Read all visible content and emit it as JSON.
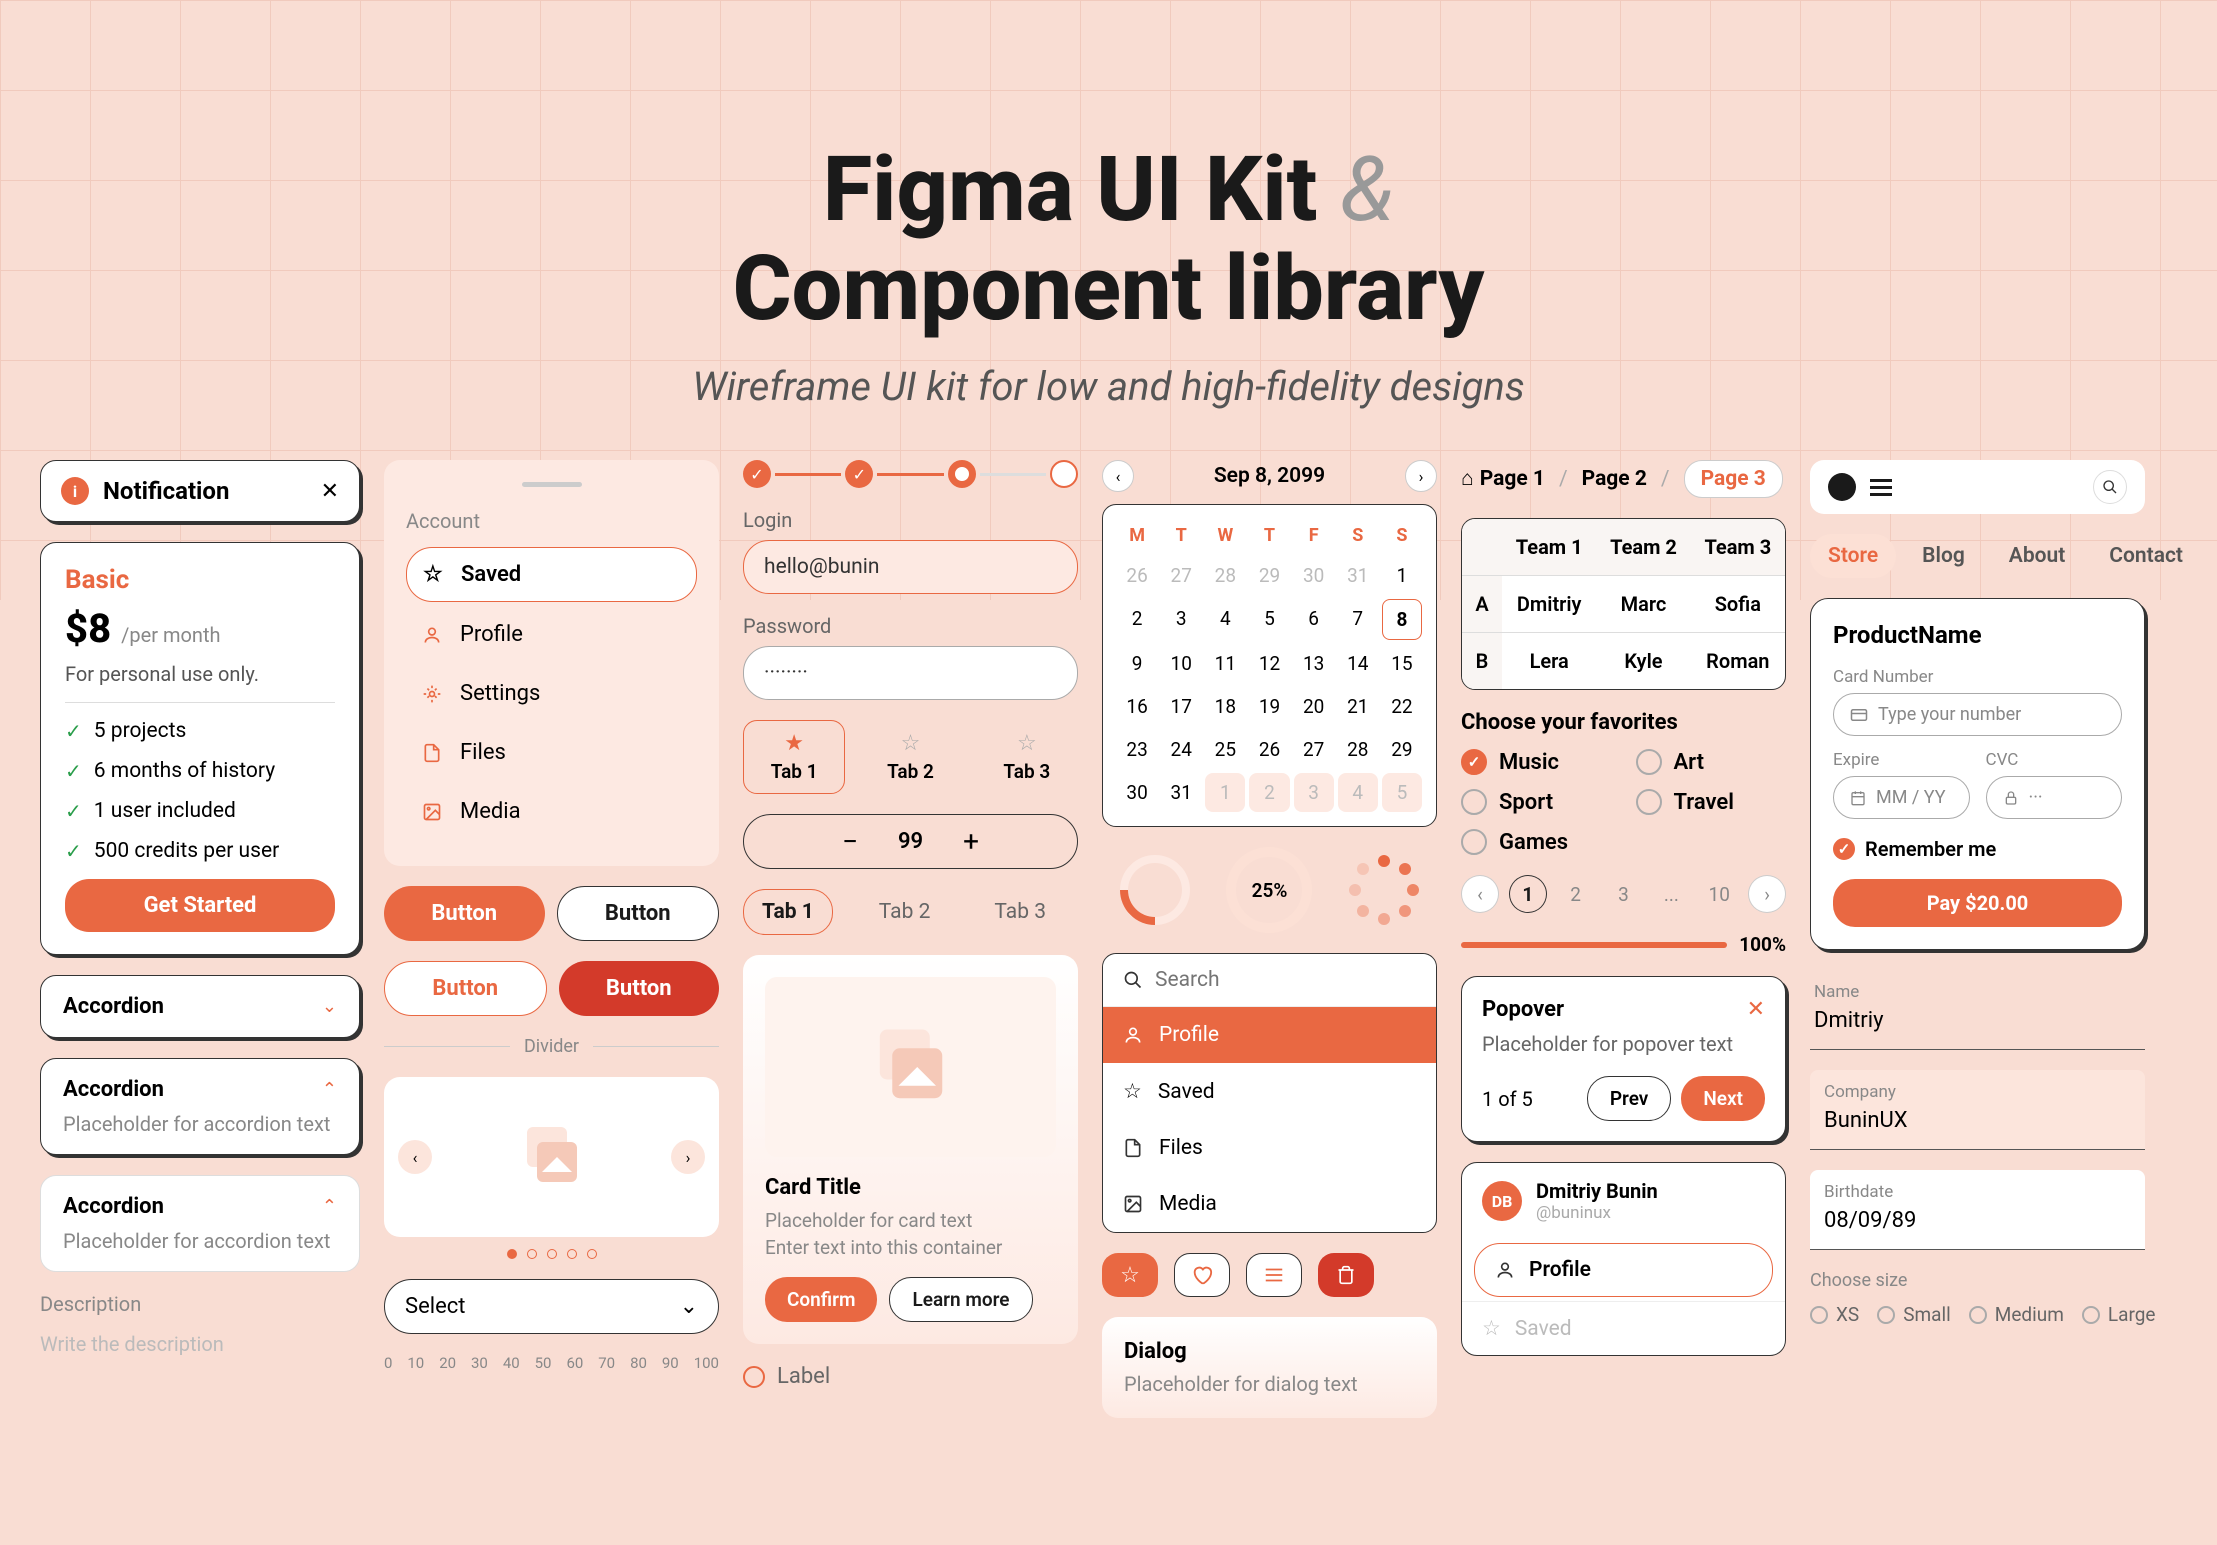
{
  "hero": {
    "title_1": "Figma UI Kit ",
    "amp": "&",
    "title_2": "Component library",
    "subtitle": "Wireframe UI kit for low and high-fidelity designs"
  },
  "notification": {
    "label": "Notification"
  },
  "pricing": {
    "tier": "Basic",
    "price": "$8",
    "per": "/per month",
    "desc": "For personal use only.",
    "features": [
      "5 projects",
      "6 months of history",
      "1 user included",
      "500 credits per user"
    ],
    "cta": "Get Started"
  },
  "accordion": {
    "label": "Accordion",
    "placeholder": "Placeholder for accordion text"
  },
  "description": {
    "label": "Description",
    "placeholder": "Write the description"
  },
  "sidebar": {
    "section": "Account",
    "items": [
      "Saved",
      "Profile",
      "Settings",
      "Files",
      "Media"
    ]
  },
  "buttons": {
    "label": "Button"
  },
  "divider": "Divider",
  "select": "Select",
  "ruler": [
    "0",
    "10",
    "20",
    "30",
    "40",
    "50",
    "60",
    "70",
    "80",
    "90",
    "100"
  ],
  "login": {
    "login_label": "Login",
    "login_value": "hello@bunin",
    "pw_label": "Password",
    "pw_value": "········"
  },
  "icon_tabs": [
    "Tab 1",
    "Tab 2",
    "Tab 3"
  ],
  "stepper_value": "99",
  "text_tabs": [
    "Tab 1",
    "Tab 2",
    "Tab 3"
  ],
  "card": {
    "title": "Card Title",
    "line1": "Placeholder for card text",
    "line2": "Enter text into this container",
    "confirm": "Confirm",
    "learn": "Learn more"
  },
  "radio_label": "Label",
  "calendar": {
    "title": "Sep 8, 2099",
    "days": [
      "M",
      "T",
      "W",
      "T",
      "F",
      "S",
      "S"
    ],
    "prev": [
      "26",
      "27",
      "28",
      "29",
      "30",
      "31"
    ],
    "cells": [
      "1",
      "2",
      "3",
      "4",
      "5",
      "6",
      "7",
      "8",
      "9",
      "10",
      "11",
      "12",
      "13",
      "14",
      "15",
      "16",
      "17",
      "18",
      "19",
      "20",
      "21",
      "22",
      "23",
      "24",
      "25",
      "26",
      "27",
      "28",
      "29",
      "30",
      "31"
    ],
    "next": [
      "1",
      "2",
      "3",
      "4",
      "5"
    ],
    "selected": "8"
  },
  "donut_pct": "25%",
  "search_placeholder": "Search",
  "menu": [
    "Profile",
    "Saved",
    "Files",
    "Media"
  ],
  "dialog": {
    "title": "Dialog",
    "text": "Placeholder for dialog text"
  },
  "breadcrumb": [
    "Page 1",
    "Page 2",
    "Page 3"
  ],
  "table": {
    "cols": [
      "Team 1",
      "Team 2",
      "Team 3"
    ],
    "rows": [
      {
        "label": "A",
        "cells": [
          "Dmitriy",
          "Marc",
          "Sofia"
        ]
      },
      {
        "label": "B",
        "cells": [
          "Lera",
          "Kyle",
          "Roman"
        ]
      }
    ]
  },
  "favorites": {
    "title": "Choose your favorites",
    "items": [
      "Music",
      "Art",
      "Sport",
      "Travel",
      "Games"
    ]
  },
  "pagination": [
    "1",
    "2",
    "3",
    "...",
    "10"
  ],
  "progress_pct": "100%",
  "popover": {
    "title": "Popover",
    "text": "Placeholder for popover text",
    "count": "1 of 5",
    "prev": "Prev",
    "next": "Next"
  },
  "user": {
    "initials": "DB",
    "name": "Dmitriy Bunin",
    "handle": "@buninux",
    "items": [
      "Profile",
      "Saved"
    ]
  },
  "nav": [
    "Store",
    "Blog",
    "About",
    "Contact"
  ],
  "payment": {
    "title": "ProductName",
    "card_label": "Card Number",
    "card_placeholder": "Type your number",
    "expire_label": "Expire",
    "expire_placeholder": "MM / YY",
    "cvc_label": "CVC",
    "cvc_placeholder": "···",
    "remember": "Remember me",
    "pay": "Pay $20.00"
  },
  "form": {
    "name_label": "Name",
    "name_value": "Dmitriy",
    "company_label": "Company",
    "company_value": "BuninUX",
    "birth_label": "Birthdate",
    "birth_value": "08/09/89"
  },
  "sizes": {
    "title": "Choose size",
    "options": [
      "XS",
      "Small",
      "Medium",
      "Large"
    ]
  }
}
